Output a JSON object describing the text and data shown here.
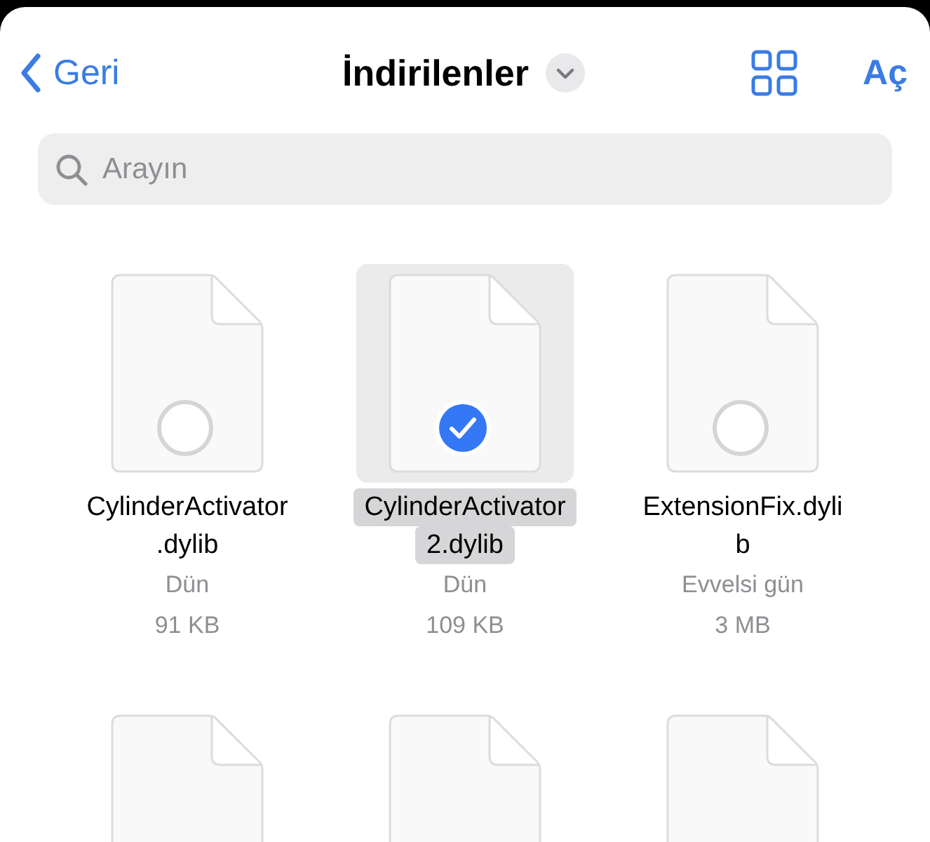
{
  "nav": {
    "back": "Geri",
    "title": "İndirilenler",
    "action": "Aç"
  },
  "search": {
    "placeholder": "Arayın"
  },
  "files": [
    {
      "name_lines": [
        "CylinderActivator",
        ".dylib"
      ],
      "date": "Dün",
      "size": "91 KB",
      "selected": false
    },
    {
      "name_lines": [
        "CylinderActivator",
        "2.dylib"
      ],
      "date": "Dün",
      "size": "109 KB",
      "selected": true
    },
    {
      "name_lines": [
        "ExtensionFix.dyli",
        "b"
      ],
      "date": "Evvelsi gün",
      "size": "3 MB",
      "selected": false
    }
  ],
  "more_files": [
    {
      "kind": "document"
    },
    {
      "kind": "document"
    },
    {
      "kind": "document"
    }
  ]
}
